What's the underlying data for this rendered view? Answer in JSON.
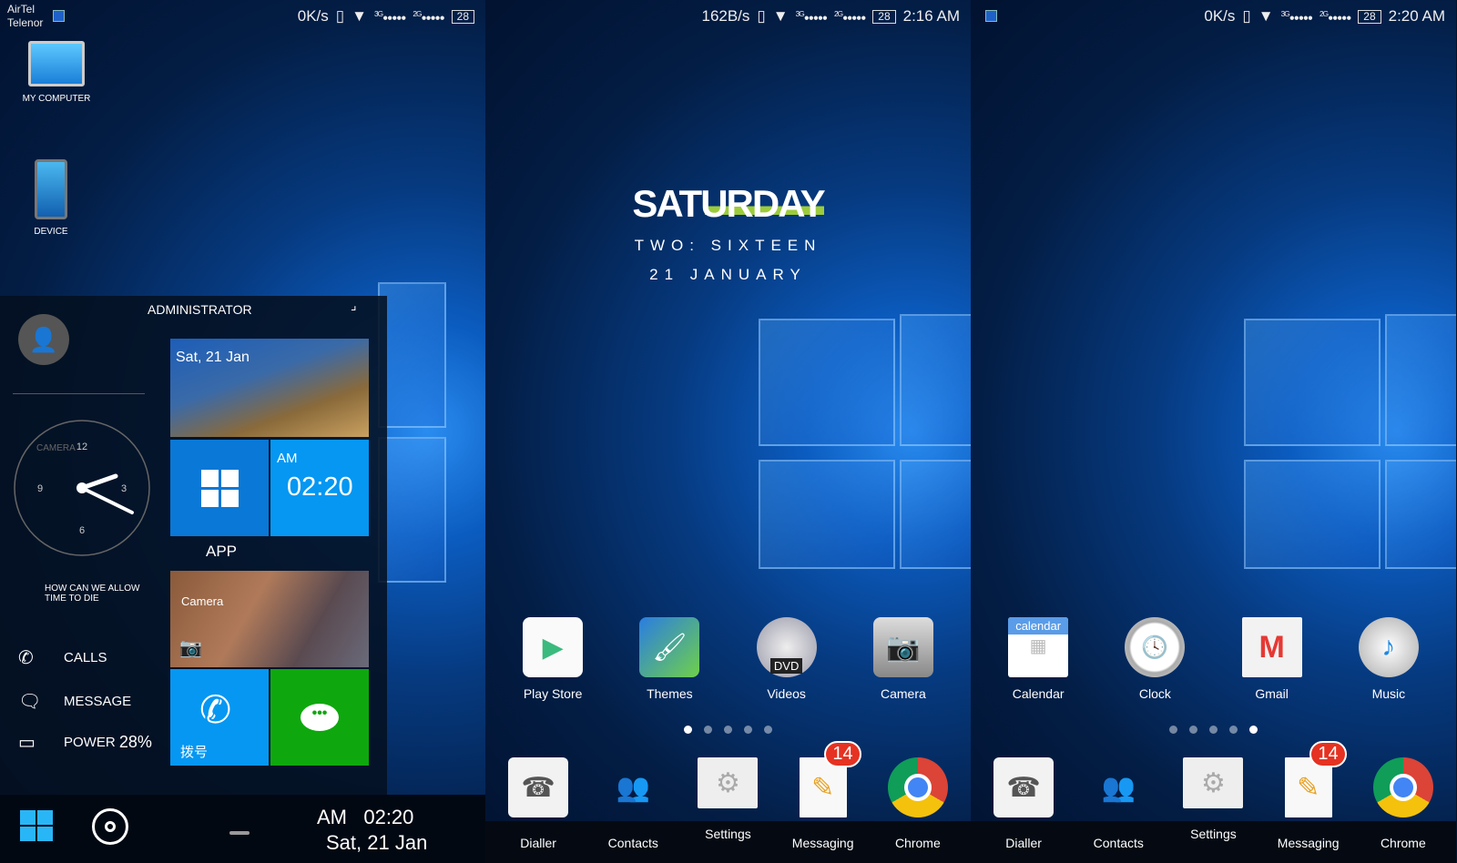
{
  "screens": [
    {
      "status": {
        "carrier1": "AirTel",
        "carrier2": "Telenor",
        "speed": "0K/s",
        "net1": "3G",
        "net2": "2G",
        "signal": "●●●●●",
        "battery": "28"
      },
      "desktop_icons": [
        {
          "label": "MY COMPUTER"
        },
        {
          "label": "DEVICE"
        }
      ],
      "start": {
        "user": "ADMINISTRATOR",
        "camera_ghost": "CAMERA",
        "quote": "HOW CAN WE ALLOW TIME TO DIE",
        "tiles": {
          "photo_date": "Sat, 21 Jan",
          "clock_ampm": "AM",
          "clock_time": "02:20",
          "section": "APP",
          "camera": "Camera",
          "dial": "拨号"
        },
        "clock_numbers": [
          "12",
          "3",
          "6",
          "9"
        ],
        "links": [
          {
            "label": "CALLS"
          },
          {
            "label": "MESSAGE"
          },
          {
            "label": "POWER",
            "value": "28%"
          }
        ]
      },
      "taskbar": {
        "ampm": "AM",
        "time": "02:20",
        "date": "Sat, 21 Jan"
      }
    },
    {
      "status": {
        "speed": "162B/s",
        "net1": "3G",
        "net2": "2G",
        "signal": "●●●●●",
        "battery": "28",
        "time": "2:16 AM"
      },
      "widget": {
        "day": "SATURDAY",
        "time": "TWO: SIXTEEN",
        "date": "21 JANUARY"
      },
      "apps": [
        "Play Store",
        "Themes",
        "Videos",
        "Camera"
      ],
      "dvd": "DVD",
      "page": 1,
      "dock": [
        "Dialler",
        "Contacts",
        "Settings",
        "Messaging",
        "Chrome"
      ],
      "badge": "14"
    },
    {
      "status": {
        "speed": "0K/s",
        "net1": "3G",
        "net2": "2G",
        "signal": "●●●●●",
        "battery": "28",
        "time": "2:20 AM"
      },
      "apps": [
        "Calendar",
        "Clock",
        "Gmail",
        "Music"
      ],
      "cal": "calendar",
      "page": 5,
      "dock": [
        "Dialler",
        "Contacts",
        "Settings",
        "Messaging",
        "Chrome"
      ],
      "badge": "14"
    }
  ],
  "colors": {
    "tile_blue": "#0a78d7",
    "tile_lightblue": "#0597f2",
    "tile_green": "#0ea80e"
  }
}
